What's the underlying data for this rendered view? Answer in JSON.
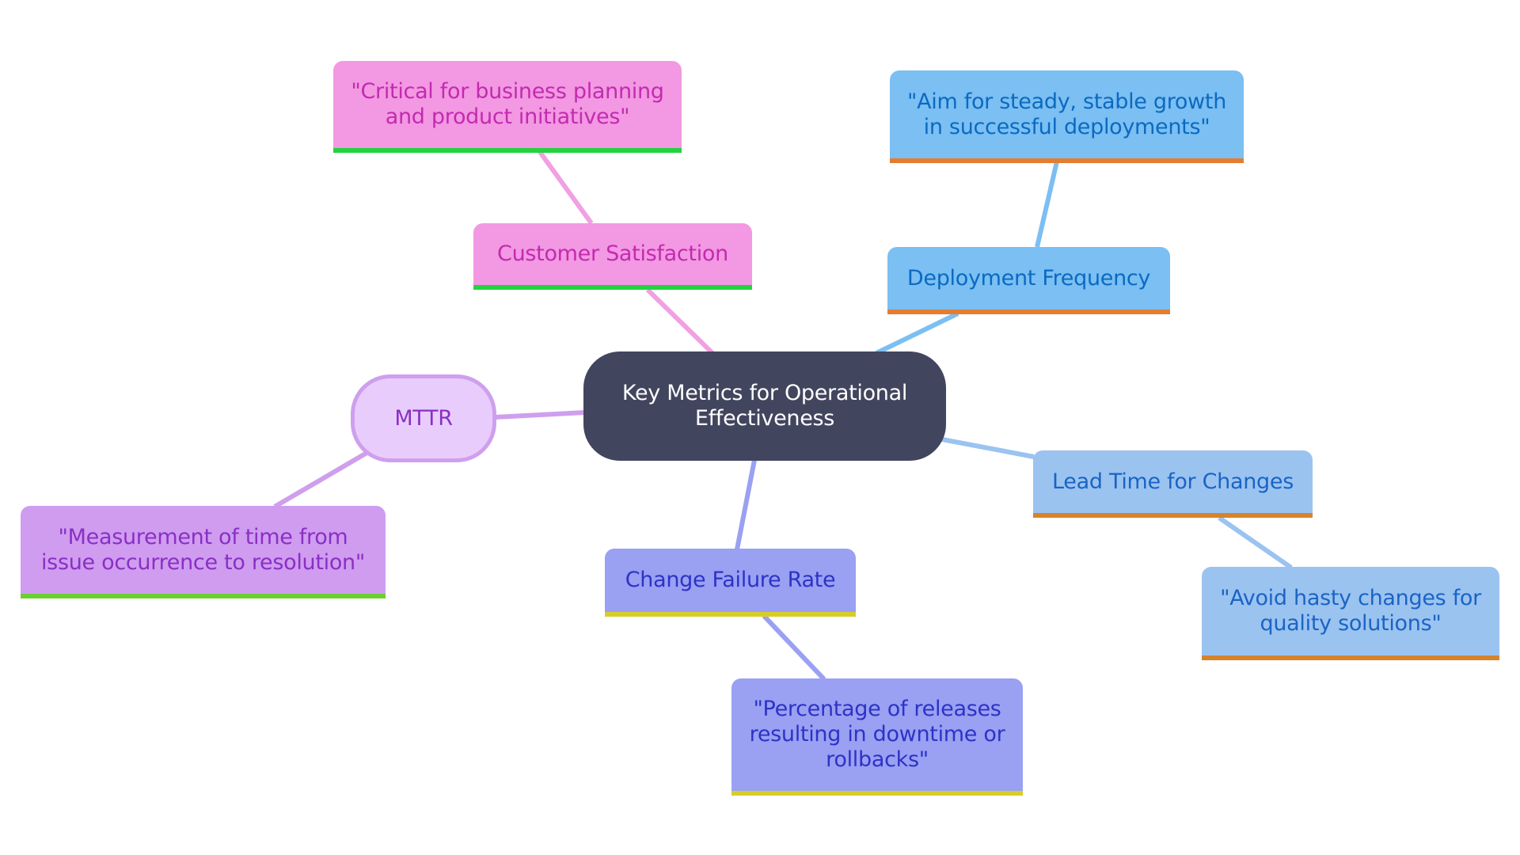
{
  "diagram": {
    "type": "mindmap",
    "root": {
      "label": "Key Metrics for Operational\nEffectiveness",
      "color": "#42455e"
    },
    "branches": [
      {
        "id": "cust",
        "label": "Customer Satisfaction",
        "fill": "#f398e2",
        "text_color": "#c22bb0",
        "accent": "#22d33f",
        "child": {
          "id": "crit",
          "label": "\"Critical for business planning\nand product initiatives\""
        }
      },
      {
        "id": "deploy",
        "label": "Deployment Frequency",
        "fill": "#7bbff3",
        "text_color": "#0b6ac0",
        "accent": "#e47d30",
        "child": {
          "id": "aim",
          "label": "\"Aim for steady, stable growth\nin successful deployments\""
        }
      },
      {
        "id": "lead",
        "label": "Lead Time for Changes",
        "fill": "#9bc3f0",
        "text_color": "#1a64c4",
        "accent": "#d5842a",
        "child": {
          "id": "avoid",
          "label": "\"Avoid hasty changes for\nquality solutions\""
        }
      },
      {
        "id": "cfr",
        "label": "Change Failure Rate",
        "fill": "#9aa0f2",
        "text_color": "#2c33c6",
        "accent": "#d8cd28",
        "child": {
          "id": "perc",
          "label": "\"Percentage of releases\nresulting in downtime or\nrollbacks\""
        }
      },
      {
        "id": "mttr",
        "label": "MTTR",
        "fill": "#e8cdfc",
        "text_color": "#8a2fc4",
        "accent": "#cf9fee",
        "child": {
          "id": "meas",
          "label": "\"Measurement of time from\nissue occurrence to resolution\"",
          "accent": "#6ad12e"
        }
      }
    ],
    "edge_colors": {
      "cust": "#f0a0e3",
      "deploy": "#7bbff3",
      "lead": "#9bc3f0",
      "cfr": "#9aa0f2",
      "mttr": "#cf9fee"
    }
  }
}
